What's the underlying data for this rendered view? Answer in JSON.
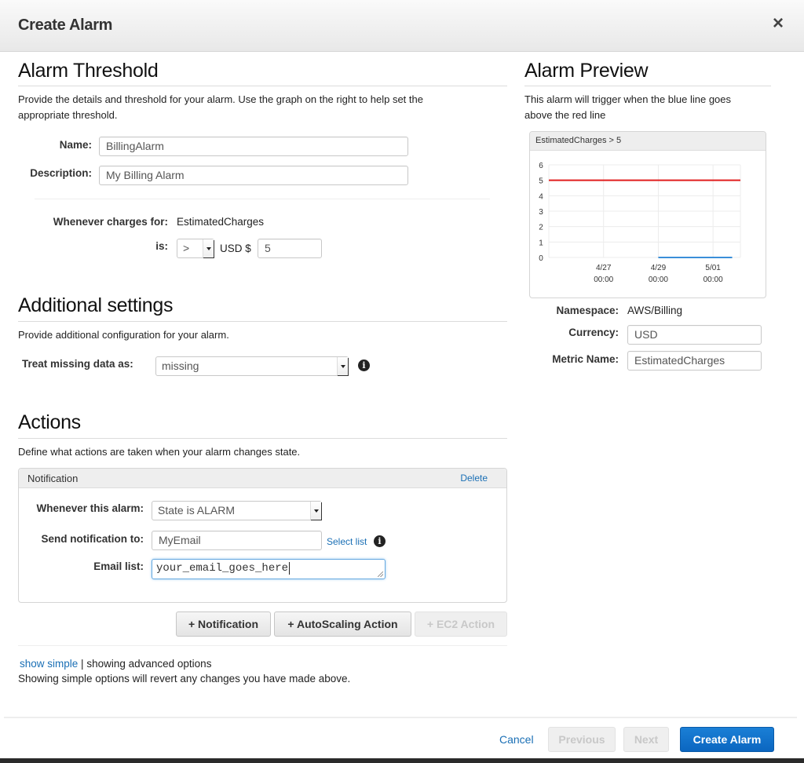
{
  "dialog": {
    "title": "Create Alarm",
    "close_icon": "×"
  },
  "threshold": {
    "heading": "Alarm Threshold",
    "description": "Provide the details and threshold for your alarm. Use the graph on the right to help set the",
    "description_line2": "appropriate threshold.",
    "name_label": "Name:",
    "name_value": "BillingAlarm",
    "description_label": "Description:",
    "description_value": "My Billing Alarm",
    "whenever_label": "Whenever charges for:",
    "whenever_value": "EstimatedCharges",
    "is_label": "is:",
    "operator_value": ">",
    "currency_prefix": "USD $",
    "threshold_value": "5"
  },
  "additional": {
    "heading": "Additional settings",
    "description": "Provide additional configuration for your alarm.",
    "missing_label": "Treat missing data as:",
    "missing_value": "missing"
  },
  "actions": {
    "heading": "Actions",
    "description": "Define what actions are taken when your alarm changes state.",
    "notification": {
      "title": "Notification",
      "delete_label": "Delete",
      "whenever_label": "Whenever this alarm:",
      "whenever_value": "State is ALARM",
      "send_label": "Send notification to:",
      "send_value": "MyEmail",
      "select_list_label": "Select list",
      "email_label": "Email list:",
      "email_value": "your_email_goes_here"
    },
    "buttons": {
      "notification": "+ Notification",
      "autoscaling": "+ AutoScaling Action",
      "ec2": "+ EC2 Action"
    }
  },
  "mode": {
    "show_simple": "show simple",
    "separator": "|",
    "showing_advanced": "showing advanced options",
    "warning": "Showing simple options will revert any changes you have made above."
  },
  "preview": {
    "heading": "Alarm Preview",
    "description": "This alarm will trigger when the blue line goes",
    "description_line2": "above the red line",
    "namespace_label": "Namespace:",
    "namespace_value": "AWS/Billing",
    "currency_label": "Currency:",
    "currency_value": "USD",
    "metric_label": "Metric Name:",
    "metric_value": "EstimatedCharges"
  },
  "footer": {
    "cancel": "Cancel",
    "previous": "Previous",
    "next": "Next",
    "create": "Create Alarm"
  },
  "colors": {
    "threshold_line": "#e01e1e",
    "metric_line": "#3a8fd9",
    "primary": "#0b6ec5",
    "link": "#1a6fb5"
  },
  "chart_data": {
    "type": "line",
    "title": "EstimatedCharges > 5",
    "xlabel": "",
    "ylabel": "",
    "ylim": [
      0,
      6
    ],
    "yticks": [
      "0",
      "1",
      "2",
      "3",
      "4",
      "5",
      "6"
    ],
    "xticks": [
      {
        "label": "4/27",
        "sublabel": "00:00",
        "pos": 1
      },
      {
        "label": "4/29",
        "sublabel": "00:00",
        "pos": 2
      },
      {
        "label": "5/01",
        "sublabel": "00:00",
        "pos": 3
      }
    ],
    "xlim": [
      0,
      3.5
    ],
    "grid": true,
    "series": [
      {
        "name": "threshold",
        "color": "#e01e1e",
        "x": [
          0,
          3.5
        ],
        "y": [
          5,
          5
        ]
      },
      {
        "name": "EstimatedCharges",
        "color": "#3a8fd9",
        "x": [
          2.0,
          3.35
        ],
        "y": [
          0,
          0
        ]
      }
    ]
  }
}
